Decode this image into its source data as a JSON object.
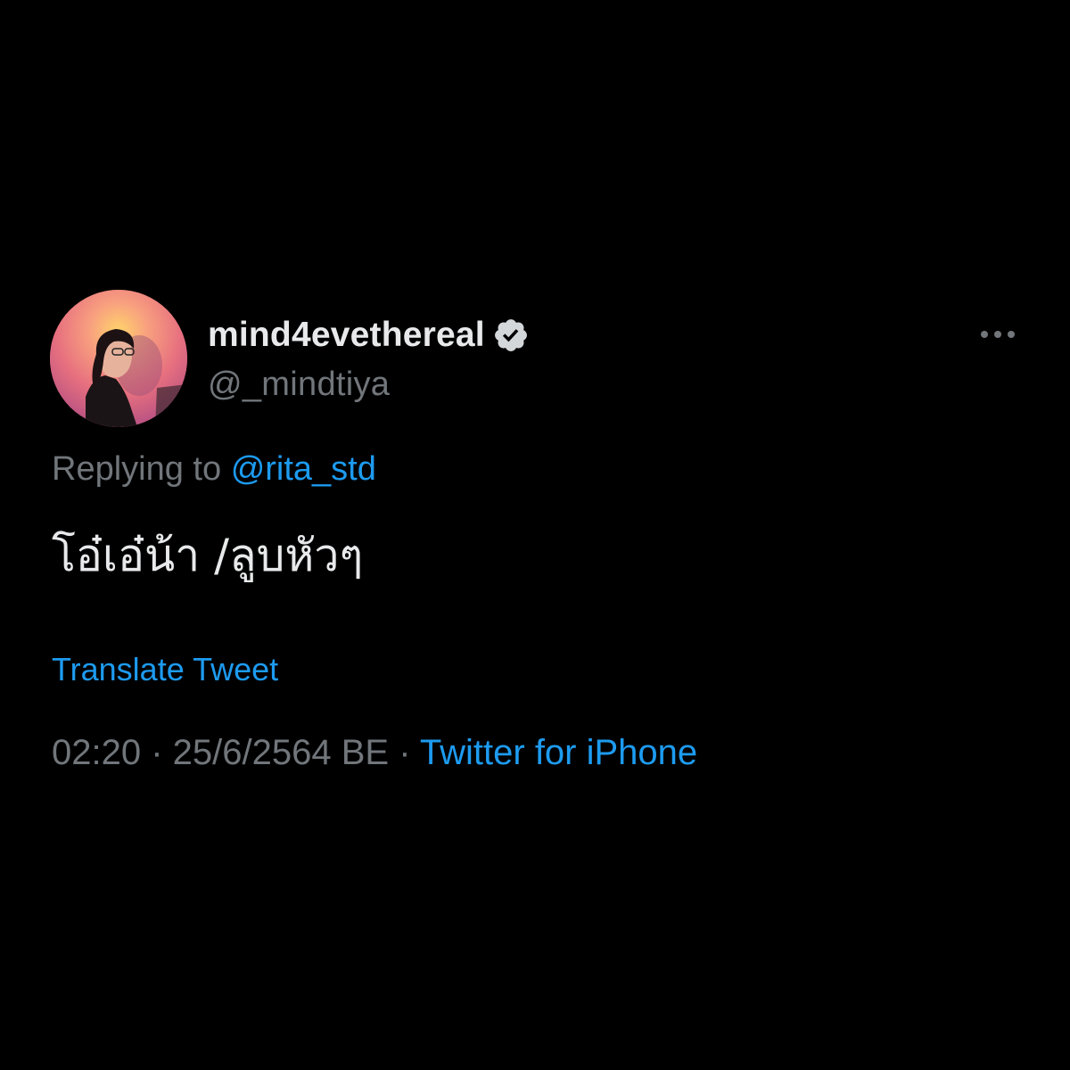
{
  "tweet": {
    "display_name": "mind4evethereal",
    "handle": "@_mindtiya",
    "verified_icon": "verified-badge-icon",
    "more_icon": "more-options-icon",
    "replying_prefix": "Replying to",
    "replying_to": "@rita_std",
    "text": "โอ๋เอ๋น้า /ลูบหัวๆ",
    "translate_label": "Translate Tweet",
    "time": "02:20",
    "separator": " · ",
    "date": "25/6/2564 BE",
    "source": "Twitter for iPhone"
  },
  "colors": {
    "background": "#000000",
    "text_primary": "#e7e9ea",
    "text_secondary": "#71767b",
    "accent": "#1d9bf0"
  }
}
